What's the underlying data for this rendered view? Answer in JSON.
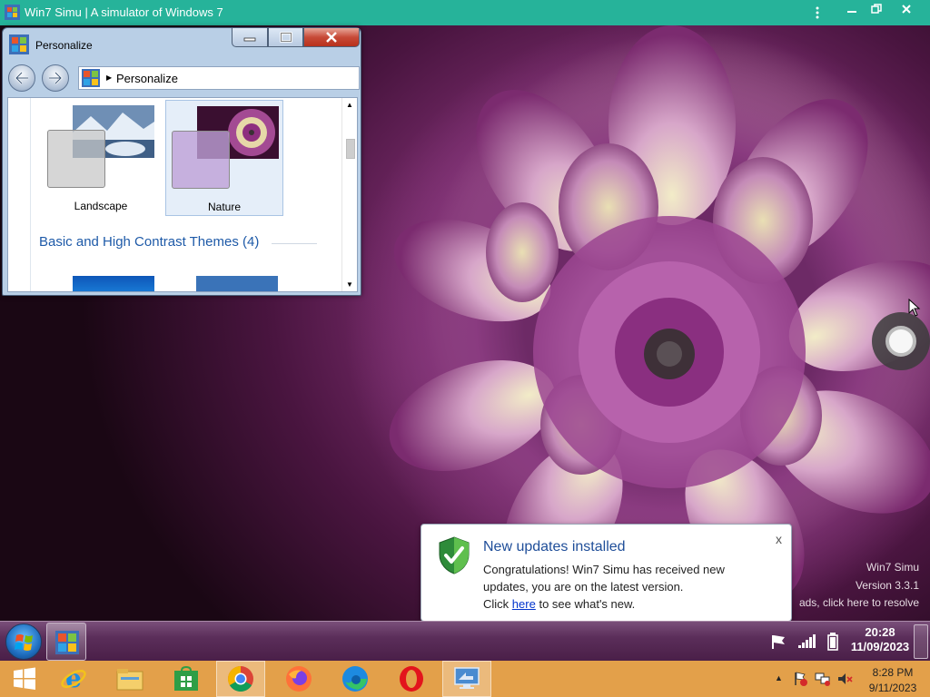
{
  "host_window": {
    "title": "Win7 Simu | A simulator of Windows 7",
    "bar_color": "#26b39a"
  },
  "personalize": {
    "title": "Personalize",
    "breadcrumb": "Personalize",
    "themes": [
      {
        "name": "Landscape",
        "selected": false
      },
      {
        "name": "Nature",
        "selected": true
      }
    ],
    "section_heading": "Basic and High Contrast Themes (4)"
  },
  "watermark": {
    "line1": "Win7 Simu",
    "line2": "Version 3.3.1",
    "line3": "ads, click here to resolve"
  },
  "notification": {
    "title": "New updates installed",
    "close": "x",
    "body_line1": "Congratulations! Win7 Simu has received new",
    "body_line2": "updates, you are on the latest version.",
    "body_click": "Click",
    "link": "here",
    "body_tail": "to see what's new."
  },
  "taskbar7": {
    "time": "20:28",
    "date": "11/09/2023"
  },
  "taskbar8": {
    "time": "8:28 PM",
    "date": "9/11/2023",
    "color": "#e3a04a",
    "pinned": [
      "windows-logo",
      "internet-explorer",
      "file-explorer",
      "store",
      "chrome",
      "firefox",
      "edge",
      "opera",
      "remote-desktop"
    ]
  }
}
